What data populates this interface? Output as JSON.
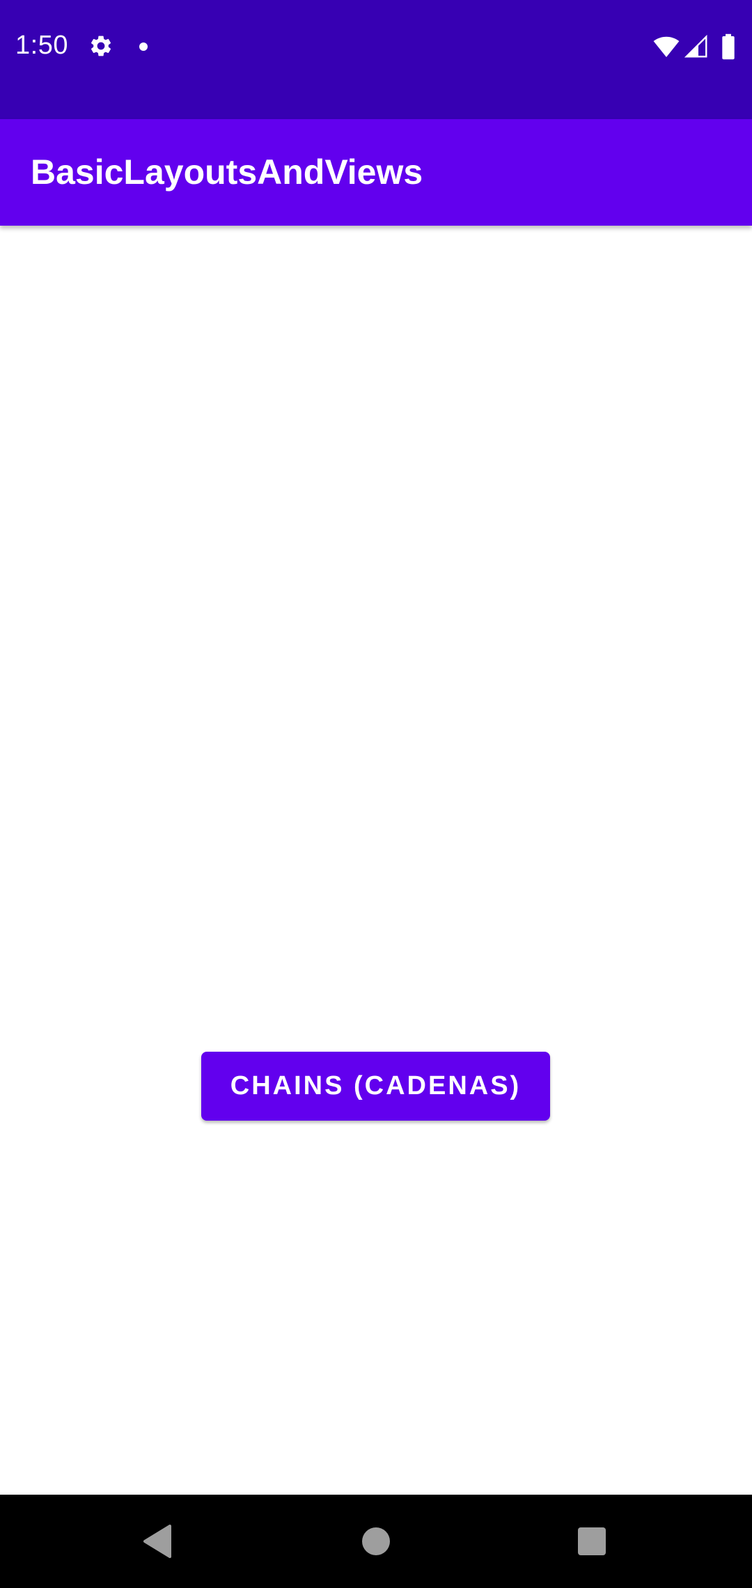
{
  "status_bar": {
    "time": "1:50",
    "icons": [
      "settings-icon",
      "notification-dot-icon",
      "wifi-icon",
      "cell-signal-icon",
      "battery-icon"
    ]
  },
  "app_bar": {
    "title": "BasicLayoutsAndViews"
  },
  "main": {
    "chains_button_label": "CHAINS (CADENAS)"
  },
  "nav_bar": {
    "icons": [
      "back-icon",
      "home-icon",
      "recents-icon"
    ]
  },
  "colors": {
    "status_bar": "#3700b3",
    "primary": "#6200ee",
    "background": "#ffffff",
    "nav_bar": "#000000",
    "on_primary": "#ffffff"
  }
}
